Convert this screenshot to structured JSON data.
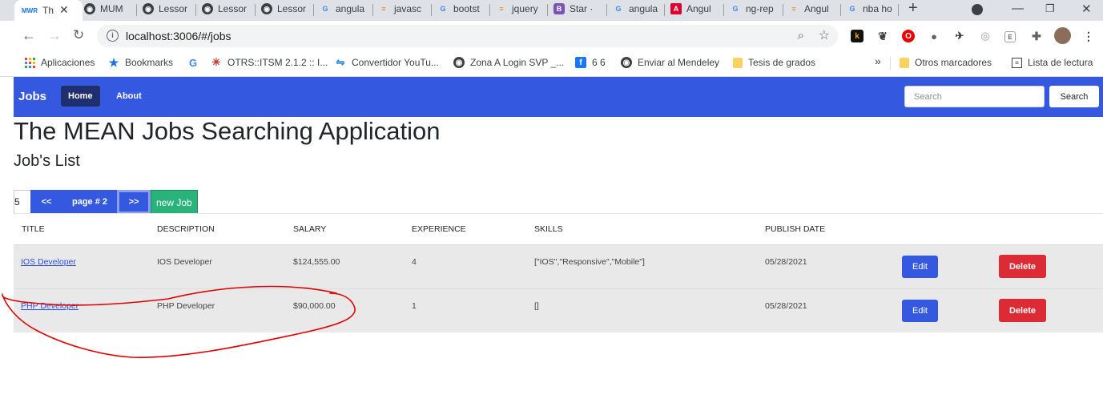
{
  "browser": {
    "tabs": [
      {
        "title": "Th",
        "icon": "mwr-favicon",
        "active": true
      },
      {
        "title": "MUM",
        "icon": "globe-favicon"
      },
      {
        "title": "Lessor",
        "icon": "globe-favicon"
      },
      {
        "title": "Lessor",
        "icon": "globe-favicon"
      },
      {
        "title": "Lessor",
        "icon": "globe-favicon"
      },
      {
        "title": "angula",
        "icon": "google-favicon"
      },
      {
        "title": "javasc",
        "icon": "stackoverflow-favicon"
      },
      {
        "title": "bootst",
        "icon": "google-favicon"
      },
      {
        "title": "jquery",
        "icon": "stackoverflow-favicon"
      },
      {
        "title": "Star ·",
        "icon": "bootstrap-favicon"
      },
      {
        "title": "angula",
        "icon": "google-favicon"
      },
      {
        "title": "Angul",
        "icon": "angular-favicon"
      },
      {
        "title": "ng-rep",
        "icon": "google-favicon"
      },
      {
        "title": "Angul",
        "icon": "stackoverflow-favicon"
      },
      {
        "title": "nba ho",
        "icon": "google-favicon"
      }
    ],
    "tab_favicon_text": "MWR",
    "new_tab": "+",
    "url": "localhost:3006/#/jobs",
    "bookmarks": [
      {
        "label": "Aplicaciones",
        "icon": "apps-grid-icon"
      },
      {
        "label": "Bookmarks",
        "icon": "star-icon"
      },
      {
        "label": "",
        "icon": "google-icon"
      },
      {
        "label": "OTRS::ITSM 2.1.2 :: I...",
        "icon": "otrs-icon"
      },
      {
        "label": "Convertidor YouTu...",
        "icon": "converter-icon"
      },
      {
        "label": "Zona A Login SVP _...",
        "icon": "globe-icon"
      },
      {
        "label": "6 6",
        "icon": "facebook-icon"
      },
      {
        "label": "Enviar al Mendeley",
        "icon": "globe-icon"
      },
      {
        "label": "Tesis de grados",
        "icon": "folder-icon"
      }
    ],
    "bookmarks_overflow": "»",
    "other_bookmarks": "Otros marcadores",
    "reading_list": "Lista de lectura",
    "colors": {
      "tabstrip": "#dee1e6",
      "omnibox": "#f1f3f4"
    }
  },
  "navbar": {
    "brand": "Jobs",
    "links": [
      {
        "label": "Home",
        "active": true
      },
      {
        "label": "About",
        "active": false
      }
    ],
    "search_placeholder": "Search",
    "search_button": "Search",
    "color": "#3458e0"
  },
  "page": {
    "title": "The MEAN Jobs Searching Application",
    "subtitle": "Job's List"
  },
  "pager": {
    "page_size": "5",
    "prev": "<<",
    "page_label": "page # 2",
    "next": ">>",
    "new_job": "new Job"
  },
  "table": {
    "headers": [
      "TITLE",
      "DESCRIPTION",
      "SALARY",
      "EXPERIENCE",
      "SKILLS",
      "PUBLISH DATE"
    ],
    "rows": [
      {
        "title": "IOS Developer",
        "description": "IOS Developer",
        "salary": "$124,555.00",
        "experience": "4",
        "skills": "[\"IOS\",\"Responsive\",\"Mobile\"]",
        "publish_date": "05/28/2021",
        "edit": "Edit",
        "delete": "Delete"
      },
      {
        "title": "PHP Developer",
        "description": "PHP Developer",
        "salary": "$90,000.00",
        "experience": "1",
        "skills": "[]",
        "publish_date": "05/28/2021",
        "edit": "Edit",
        "delete": "Delete"
      }
    ],
    "colors": {
      "edit": "#3458e0",
      "delete": "#dc2b35",
      "row_bg": "#e9e9e9",
      "link": "#2a4fe0"
    }
  },
  "annotation": {
    "shape": "hand-drawn-circle",
    "color": "#e00000",
    "encloses": "PHP Developer row"
  }
}
